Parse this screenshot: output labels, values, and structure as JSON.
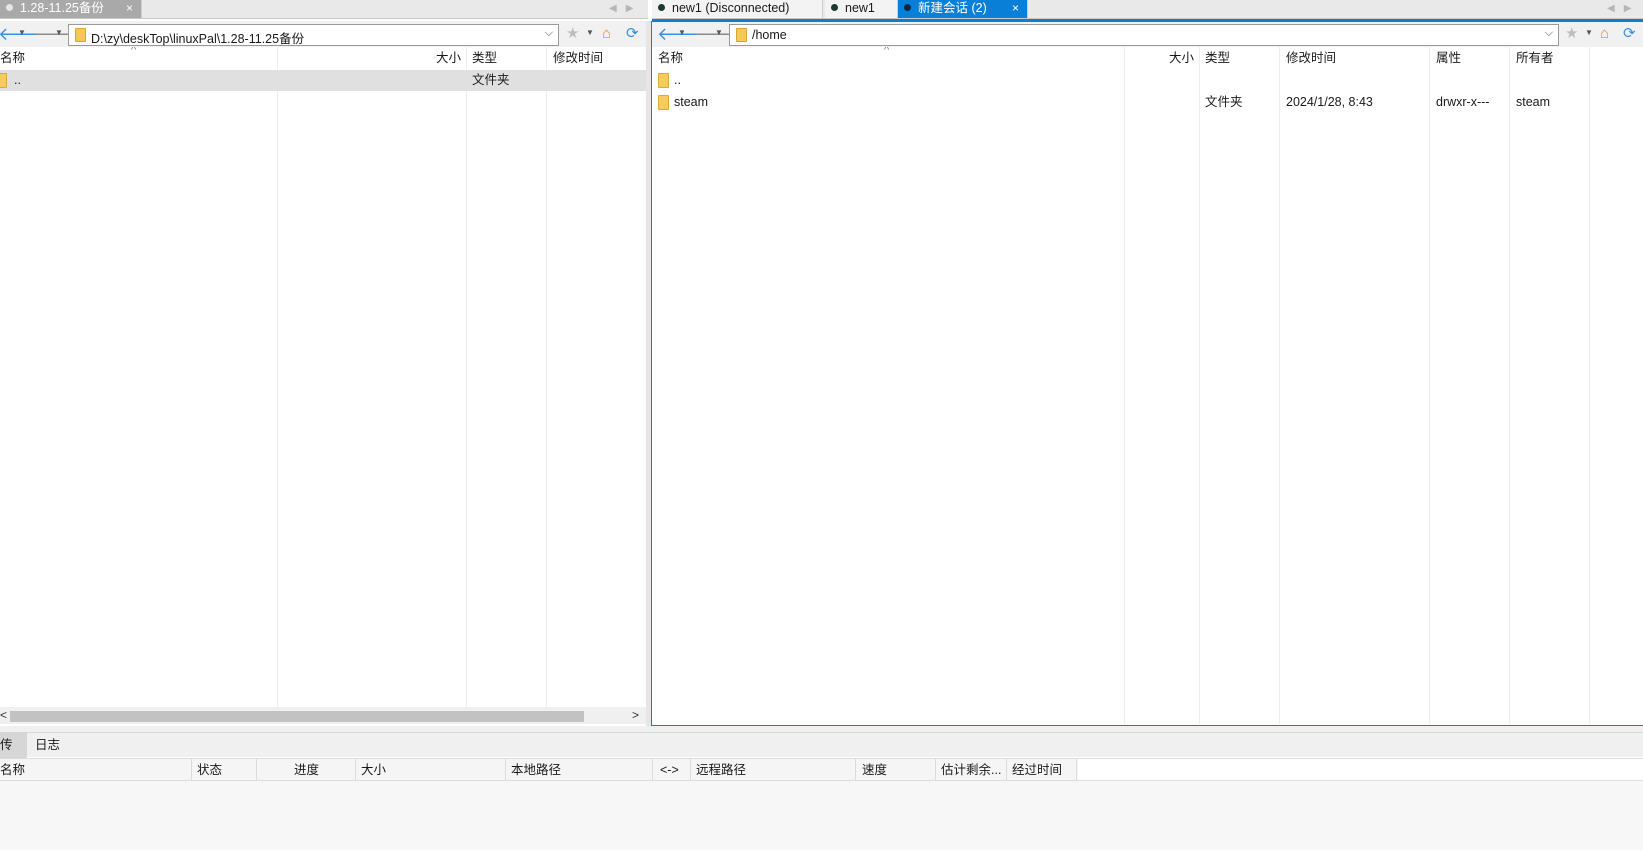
{
  "left_tabs": [
    {
      "label": "1.28-11.25备份",
      "close": "×"
    }
  ],
  "right_tabs": [
    {
      "label": "new1 (Disconnected)"
    },
    {
      "label": "new1"
    },
    {
      "label": "新建会话 (2)",
      "close": "×"
    }
  ],
  "tab_scroll_arrows": "◀▶",
  "left_toolbar": {
    "back": "🡐",
    "forward": "🡒",
    "dropdown": "▼",
    "path": "D:\\zy\\deskTop\\linuxPal\\1.28-11.25备份",
    "path_chevron": "⌵",
    "star": "★",
    "home": "⌂",
    "refresh": "⟳"
  },
  "right_toolbar": {
    "back": "🡐",
    "forward": "🡒",
    "dropdown": "▼",
    "path": "/home",
    "path_chevron": "⌵",
    "star": "★",
    "home": "⌂",
    "refresh": "⟳"
  },
  "left_list": {
    "sort_caret": "^",
    "columns": [
      "名称",
      "大小",
      "类型",
      "修改时间"
    ],
    "rows": [
      {
        "name": "..",
        "size": "",
        "type": "文件夹",
        "modified": ""
      }
    ]
  },
  "right_list": {
    "sort_caret": "^",
    "columns": [
      "名称",
      "大小",
      "类型",
      "修改时间",
      "属性",
      "所有者"
    ],
    "rows": [
      {
        "name": "..",
        "size": "",
        "type": "",
        "modified": "",
        "attrs": "",
        "owner": ""
      },
      {
        "name": "steam",
        "size": "",
        "type": "文件夹",
        "modified": "2024/1/28, 8:43",
        "attrs": "drwxr-x---",
        "owner": "steam"
      }
    ]
  },
  "left_scroll": {
    "left_arrow": "<",
    "right_arrow": ">"
  },
  "bottom_tabs": [
    "传输",
    "日志"
  ],
  "transfer_columns": [
    "名称",
    "状态",
    "进度",
    "大小",
    "本地路径",
    "<->",
    "远程路径",
    "速度",
    "估计剩余...",
    "经过时间"
  ],
  "colors": {
    "accent": "#0a7fd8",
    "folder": "#f7cb5d",
    "selection": "#e0e0e0"
  }
}
